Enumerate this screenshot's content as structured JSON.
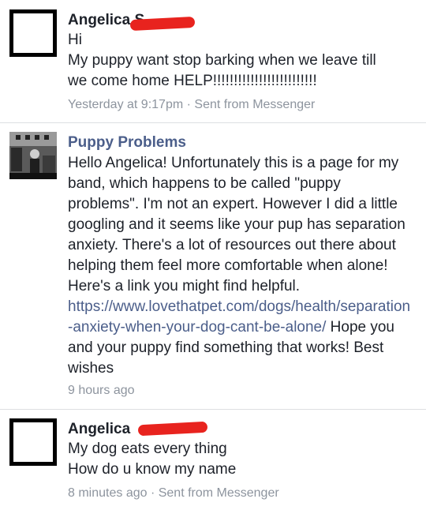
{
  "messages": [
    {
      "sender": "Angelica S",
      "lines": [
        "Hi",
        "My puppy want stop barking when we leave till",
        "we come home HELP!!!!!!!!!!!!!!!!!!!!!!!!!"
      ],
      "meta": "Yesterday at 9:17pm · Sent from Messenger"
    },
    {
      "sender": "Puppy Problems",
      "text_before_link": "Hello Angelica! Unfortunately this is a page for my band, which happens to be called \"puppy problems\". I'm not an expert. However I did a little googling and it seems like your pup has separation anxiety. There's a lot of resources out there about helping them feel more comfortable when alone! Here's a link you might find helpful. ",
      "link": "https://www.lovethatpet.com/dogs/health/separation-anxiety-when-your-dog-cant-be-alone/",
      "text_after_link": " Hope you and your puppy find something that works! Best wishes",
      "meta": "9 hours ago"
    },
    {
      "sender": "Angelica",
      "lines": [
        "My dog eats every thing",
        "How do u know my name"
      ],
      "meta": "8 minutes ago · Sent from Messenger"
    }
  ],
  "colors": {
    "link": "#4b5e8a",
    "meta": "#8d949e",
    "redaction": "#e8231e"
  }
}
